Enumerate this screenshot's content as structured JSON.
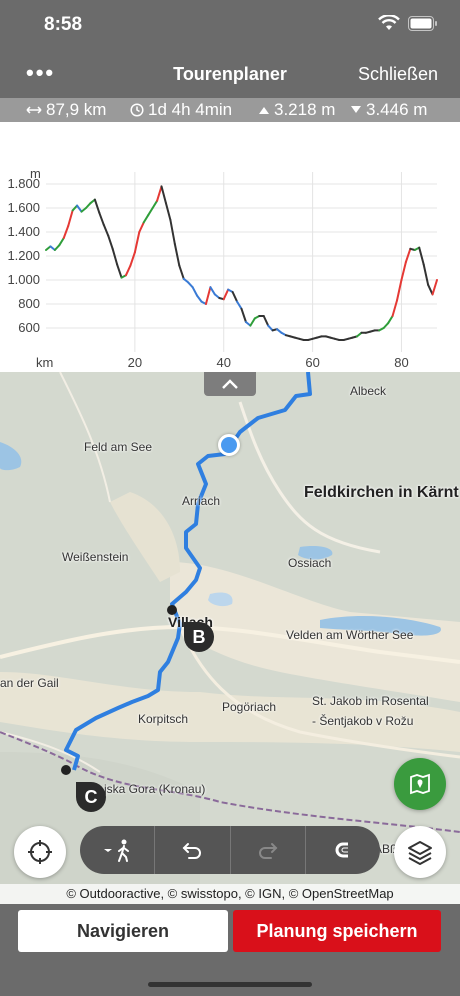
{
  "status": {
    "time": "8:58"
  },
  "nav": {
    "more_label": "•••",
    "title": "Tourenplaner",
    "close_label": "Schließen"
  },
  "stats": {
    "distance": "87,9 km",
    "duration": "1d 4h 4min",
    "ascent": "3.218 m",
    "descent": "3.446 m"
  },
  "chart_data": {
    "type": "line",
    "ylabel": "m",
    "xlabel": "km",
    "xlim": [
      0,
      88
    ],
    "ylim": [
      400,
      1900
    ],
    "yticks": [
      "1.800",
      "1.600",
      "1.400",
      "1.200",
      "1.000",
      "800",
      "600"
    ],
    "xticks": [
      "20",
      "40",
      "60",
      "80"
    ],
    "grid": true,
    "line_colors": [
      "#2f9e3a",
      "#3a7bd5",
      "#e53935",
      "#333333"
    ],
    "series": [
      {
        "x": [
          0,
          1,
          2,
          3,
          4,
          5,
          6,
          7,
          8,
          9,
          10,
          11,
          12,
          13,
          14,
          15,
          16,
          17,
          18,
          19,
          20,
          21,
          22,
          23,
          24,
          25,
          26,
          27,
          28,
          29,
          30,
          31,
          32,
          33,
          34,
          35,
          36,
          37,
          38,
          39,
          40,
          41,
          42,
          43,
          44,
          45,
          46,
          47,
          48,
          49,
          50,
          51,
          52,
          53,
          54,
          55,
          56,
          57,
          58,
          59,
          60,
          61,
          62,
          63,
          64,
          65,
          66,
          67,
          68,
          69,
          70,
          71,
          72,
          73,
          74,
          75,
          76,
          77,
          78,
          79,
          80,
          81,
          82,
          83,
          84,
          85,
          86,
          87,
          88
        ],
        "y": [
          1250,
          1280,
          1250,
          1290,
          1350,
          1450,
          1580,
          1620,
          1570,
          1600,
          1640,
          1670,
          1560,
          1460,
          1370,
          1260,
          1130,
          1020,
          1040,
          1120,
          1230,
          1400,
          1480,
          1540,
          1600,
          1660,
          1780,
          1640,
          1500,
          1300,
          1120,
          1010,
          980,
          940,
          870,
          820,
          800,
          940,
          880,
          850,
          840,
          920,
          900,
          820,
          760,
          650,
          620,
          680,
          700,
          700,
          620,
          580,
          590,
          560,
          540,
          530,
          520,
          510,
          500,
          500,
          510,
          520,
          530,
          530,
          520,
          510,
          500,
          500,
          510,
          520,
          530,
          560,
          560,
          570,
          580,
          580,
          600,
          640,
          700,
          830,
          1000,
          1150,
          1260,
          1250,
          1270,
          1130,
          960,
          880,
          1000
        ]
      }
    ]
  },
  "map": {
    "labels": [
      "Albeck",
      "Feld am See",
      "Arriach",
      "Feldkirchen in Kärnt",
      "Weißenstein",
      "Ossiach",
      "Villach",
      "Velden am Wörther See",
      "an der Gail",
      "Korpitsch",
      "Pogöriach",
      "St. Jakob im Rosental",
      "- Šentjakob v Rožu",
      "jska Gora (Kronau)",
      "ABß"
    ],
    "markers": [
      "B",
      "C"
    ],
    "attribution": "© Outdooractive, © swisstopo, © IGN, © OpenStreetMap"
  },
  "toolbar": {
    "icons": [
      "walk-mode-icon",
      "undo-icon",
      "redo-icon",
      "snap-icon"
    ]
  },
  "buttons": {
    "navigate": "Navigieren",
    "save": "Planung speichern"
  },
  "colors": {
    "header": "#6b6b6b",
    "save": "#d9101a",
    "route": "#3a8ee8",
    "green_btn": "#3a9b3e"
  }
}
